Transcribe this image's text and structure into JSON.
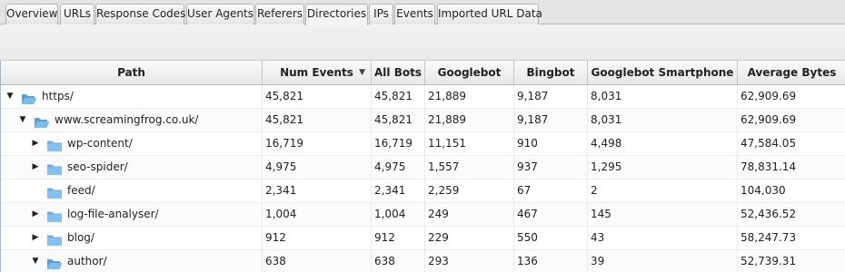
{
  "tabs": [
    {
      "label": "Overview",
      "active": false
    },
    {
      "label": "URLs",
      "active": false
    },
    {
      "label": "Response Codes",
      "active": false
    },
    {
      "label": "User Agents",
      "active": false
    },
    {
      "label": "Referers",
      "active": false
    },
    {
      "label": "Directories",
      "active": true
    },
    {
      "label": "IPs",
      "active": false
    },
    {
      "label": "Events",
      "active": false
    },
    {
      "label": "Imported URL Data",
      "active": false
    }
  ],
  "table": {
    "sorted_column": "Num Events",
    "sort_direction": "descending",
    "columns": [
      "Path",
      "Num Events",
      "All Bots",
      "Googlebot",
      "Bingbot",
      "Googlebot Smartphone",
      "Average Bytes"
    ],
    "rows": [
      {
        "path": "https/",
        "depth": 0,
        "toggle": "expanded",
        "folder": "open",
        "num_events": "45,821",
        "all_bots": "45,821",
        "googlebot": "21,889",
        "bingbot": "9,187",
        "googlebot_smartphone": "8,031",
        "average_bytes": "62,909.69"
      },
      {
        "path": "www.screamingfrog.co.uk/",
        "depth": 1,
        "toggle": "expanded",
        "folder": "open",
        "num_events": "45,821",
        "all_bots": "45,821",
        "googlebot": "21,889",
        "bingbot": "9,187",
        "googlebot_smartphone": "8,031",
        "average_bytes": "62,909.69"
      },
      {
        "path": "wp-content/",
        "depth": 2,
        "toggle": "collapsed",
        "folder": "closed",
        "num_events": "16,719",
        "all_bots": "16,719",
        "googlebot": "11,151",
        "bingbot": "910",
        "googlebot_smartphone": "4,498",
        "average_bytes": "47,584.05"
      },
      {
        "path": "seo-spider/",
        "depth": 2,
        "toggle": "collapsed",
        "folder": "closed",
        "num_events": "4,975",
        "all_bots": "4,975",
        "googlebot": "1,557",
        "bingbot": "937",
        "googlebot_smartphone": "1,295",
        "average_bytes": "78,831.14"
      },
      {
        "path": "feed/",
        "depth": 2,
        "toggle": "none",
        "folder": "closed",
        "num_events": "2,341",
        "all_bots": "2,341",
        "googlebot": "2,259",
        "bingbot": "67",
        "googlebot_smartphone": "2",
        "average_bytes": "104,030"
      },
      {
        "path": "log-file-analyser/",
        "depth": 2,
        "toggle": "collapsed",
        "folder": "closed",
        "num_events": "1,004",
        "all_bots": "1,004",
        "googlebot": "249",
        "bingbot": "467",
        "googlebot_smartphone": "145",
        "average_bytes": "52,436.52"
      },
      {
        "path": "blog/",
        "depth": 2,
        "toggle": "collapsed",
        "folder": "closed",
        "num_events": "912",
        "all_bots": "912",
        "googlebot": "229",
        "bingbot": "550",
        "googlebot_smartphone": "43",
        "average_bytes": "58,247.73"
      },
      {
        "path": "author/",
        "depth": 2,
        "toggle": "expanded",
        "folder": "open",
        "num_events": "638",
        "all_bots": "638",
        "googlebot": "293",
        "bingbot": "136",
        "googlebot_smartphone": "39",
        "average_bytes": "52,739.31"
      }
    ]
  }
}
